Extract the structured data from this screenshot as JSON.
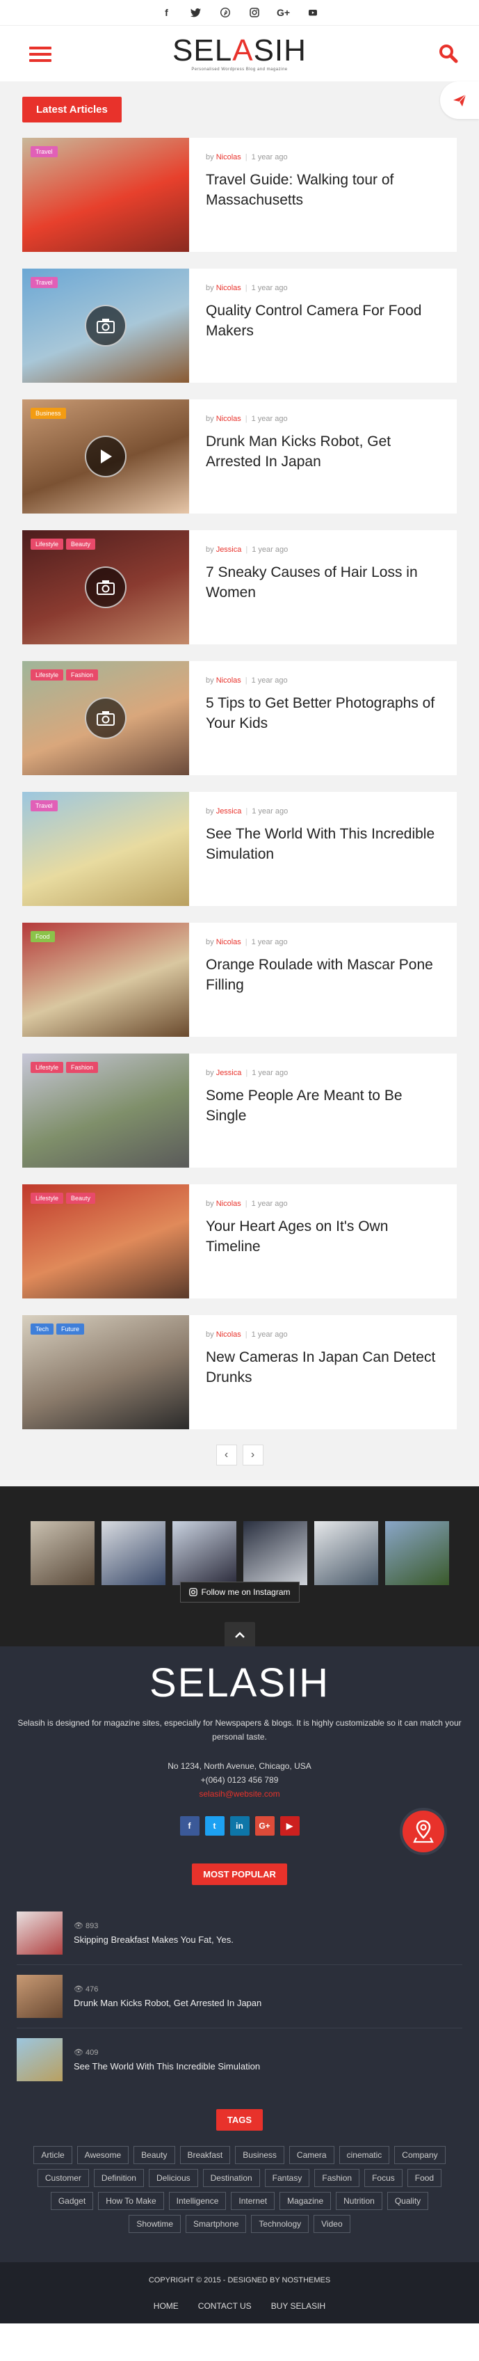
{
  "topbar": {
    "social": [
      "f",
      "t",
      "p",
      "ig",
      "G+",
      "yt"
    ]
  },
  "header": {
    "brand_a": "SEL",
    "brand_b": "A",
    "brand_c": "SIH",
    "tagline": "Personalised Wordpress   Blog and magazine"
  },
  "main": {
    "section_label": "Latest Articles",
    "articles": [
      {
        "tags": [
          {
            "label": "Travel",
            "color": "#e160b7"
          }
        ],
        "author": "Nicolas",
        "time": "1 year ago",
        "title": "Travel Guide: Walking tour of Massachusetts",
        "media": "none",
        "img": [
          "#c9b89a",
          "#e7402c",
          "#8a2a20"
        ]
      },
      {
        "tags": [
          {
            "label": "Travel",
            "color": "#e160b7"
          }
        ],
        "author": "Nicolas",
        "time": "1 year ago",
        "title": "Quality Control Camera For Food Makers",
        "media": "camera",
        "img": [
          "#6ba7d4",
          "#a8c7d8",
          "#8a5a32"
        ]
      },
      {
        "tags": [
          {
            "label": "Business",
            "color": "#f39c12"
          }
        ],
        "author": "Nicolas",
        "time": "1 year ago",
        "title": "Drunk Man Kicks Robot, Get Arrested In Japan",
        "media": "play",
        "img": [
          "#c89a74",
          "#7b5233",
          "#e6c6a8"
        ]
      },
      {
        "tags": [
          {
            "label": "Lifestyle",
            "color": "#e84a6a"
          },
          {
            "label": "Beauty",
            "color": "#e84a6a"
          }
        ],
        "author": "Jessica",
        "time": "1 year ago",
        "title": "7 Sneaky Causes of Hair Loss in Women",
        "media": "camera",
        "img": [
          "#4d1d1d",
          "#8a3b30",
          "#c38a6a"
        ]
      },
      {
        "tags": [
          {
            "label": "Lifestyle",
            "color": "#e84a6a"
          },
          {
            "label": "Fashion",
            "color": "#e84a6a"
          }
        ],
        "author": "Nicolas",
        "time": "1 year ago",
        "title": "5 Tips to Get Better Photographs of Your Kids",
        "media": "camera",
        "img": [
          "#9fb59a",
          "#d9a77c",
          "#6a4a3a"
        ]
      },
      {
        "tags": [
          {
            "label": "Travel",
            "color": "#e160b7"
          }
        ],
        "author": "Jessica",
        "time": "1 year ago",
        "title": "See The World With This Incredible Simulation",
        "media": "none",
        "img": [
          "#9cc6df",
          "#e8dba0",
          "#b9a060"
        ]
      },
      {
        "tags": [
          {
            "label": "Food",
            "color": "#8bc34a"
          }
        ],
        "author": "Nicolas",
        "time": "1 year ago",
        "title": "Orange Roulade with Mascar Pone Filling",
        "media": "none",
        "img": [
          "#b53a3a",
          "#d9c7a0",
          "#6a4a2e"
        ]
      },
      {
        "tags": [
          {
            "label": "Lifestyle",
            "color": "#e84a6a"
          },
          {
            "label": "Fashion",
            "color": "#e84a6a"
          }
        ],
        "author": "Jessica",
        "time": "1 year ago",
        "title": "Some People Are Meant to Be Single",
        "media": "none",
        "img": [
          "#c7c7d8",
          "#7f8f6a",
          "#5a5a5a"
        ]
      },
      {
        "tags": [
          {
            "label": "Lifestyle",
            "color": "#e84a6a"
          },
          {
            "label": "Beauty",
            "color": "#e84a6a"
          }
        ],
        "author": "Nicolas",
        "time": "1 year ago",
        "title": "Your Heart Ages on It's Own Timeline",
        "media": "none",
        "img": [
          "#c0392b",
          "#e08a5a",
          "#5a3a2a"
        ]
      },
      {
        "tags": [
          {
            "label": "Tech",
            "color": "#3f7fd9"
          },
          {
            "label": "Future",
            "color": "#3f7fd9"
          }
        ],
        "author": "Nicolas",
        "time": "1 year ago",
        "title": "New Cameras In Japan Can Detect Drunks",
        "media": "none",
        "img": [
          "#d8d0c0",
          "#8a7a6a",
          "#2a2a2a"
        ]
      }
    ],
    "pager": {
      "prev": "‹",
      "next": "›"
    }
  },
  "instagram": {
    "follow_label": "Follow me on Instagram",
    "tiles": [
      [
        "#c9c0b0",
        "#5a4a3a"
      ],
      [
        "#d8dbe0",
        "#3a4a6a"
      ],
      [
        "#c9d2e0",
        "#2a2a3a"
      ],
      [
        "#2a3040",
        "#d0d4da"
      ],
      [
        "#e6e8ea",
        "#4a5a6a"
      ],
      [
        "#8aa6c8",
        "#3a5a2a"
      ]
    ]
  },
  "footer": {
    "brand": "SELASIH",
    "about": "Selasih is designed for magazine sites, especially for Newspapers & blogs. It is highly customizable so it can match your personal taste.",
    "address": "No 1234, North Avenue, Chicago, USA",
    "phone": "+(064) 0123 456 789",
    "email": "selasih@website.com",
    "social": [
      {
        "label": "f",
        "color": "#3b5998"
      },
      {
        "label": "t",
        "color": "#1da1f2"
      },
      {
        "label": "in",
        "color": "#0e76a8"
      },
      {
        "label": "G+",
        "color": "#dd4b39"
      },
      {
        "label": "▶",
        "color": "#cd201f"
      }
    ],
    "popular_label": "MOST POPULAR",
    "popular": [
      {
        "views": "893",
        "title": "Skipping Breakfast Makes You Fat, Yes.",
        "img": [
          "#e8e0e0",
          "#b04040"
        ]
      },
      {
        "views": "476",
        "title": "Drunk Man Kicks Robot, Get Arrested In Japan",
        "img": [
          "#c89a74",
          "#6a4a33"
        ]
      },
      {
        "views": "409",
        "title": "See The World With This Incredible Simulation",
        "img": [
          "#9cc6df",
          "#b9a060"
        ]
      }
    ],
    "tags_label": "TAGS",
    "tags": [
      "Article",
      "Awesome",
      "Beauty",
      "Breakfast",
      "Business",
      "Camera",
      "cinematic",
      "Company",
      "Customer",
      "Definition",
      "Delicious",
      "Destination",
      "Fantasy",
      "Fashion",
      "Focus",
      "Food",
      "Gadget",
      "How To Make",
      "Intelligence",
      "Internet",
      "Magazine",
      "Nutrition",
      "Quality",
      "Showtime",
      "Smartphone",
      "Technology",
      "Video"
    ]
  },
  "copyright": {
    "text": "COPYRIGHT © 2015 - DESIGNED BY NOSTHEMES",
    "links": [
      "HOME",
      "CONTACT US",
      "BUY SELASIH"
    ]
  },
  "colors": {
    "accent": "#e8322b",
    "footer_bg": "#2b2f3a",
    "dark": "#222222"
  }
}
